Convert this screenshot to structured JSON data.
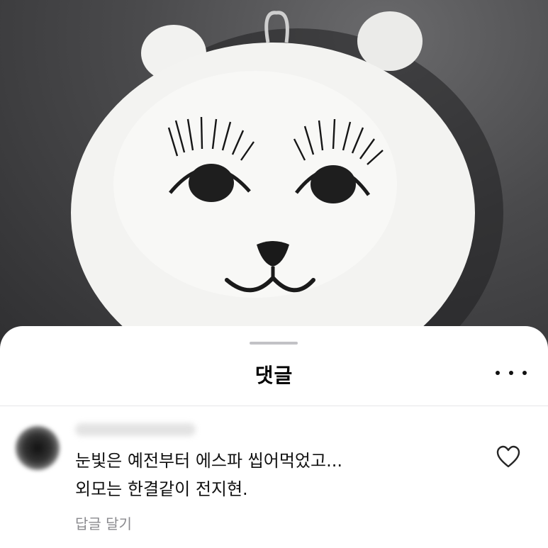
{
  "sheet": {
    "title": "댓글"
  },
  "comment": {
    "username": "",
    "lines": [
      "눈빛은 예전부터 에스파 씹어먹었고...",
      "외모는 한결같이 전지현."
    ],
    "reply_label": "답글 달기"
  },
  "icons": {
    "more": "more-horizontal-icon",
    "like": "heart-outline-icon"
  },
  "colors": {
    "sheet": "#ffffff",
    "muted": "#8a8a8e",
    "text": "#111111"
  }
}
